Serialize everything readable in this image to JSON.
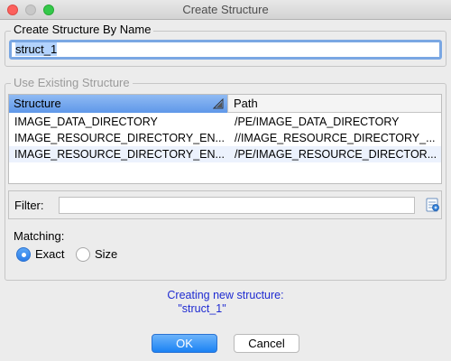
{
  "window": {
    "title": "Create Structure"
  },
  "create_by_name": {
    "legend": "Create Structure By Name",
    "value": "struct_1"
  },
  "use_existing": {
    "legend": "Use Existing Structure",
    "columns": [
      "Structure",
      "Path"
    ],
    "rows": [
      {
        "structure": "IMAGE_DATA_DIRECTORY",
        "path": "/PE/IMAGE_DATA_DIRECTORY"
      },
      {
        "structure": "IMAGE_RESOURCE_DIRECTORY_EN...",
        "path": "//IMAGE_RESOURCE_DIRECTORY_..."
      },
      {
        "structure": "IMAGE_RESOURCE_DIRECTORY_EN...",
        "path": "/PE/IMAGE_RESOURCE_DIRECTOR..."
      }
    ]
  },
  "filter": {
    "label": "Filter:",
    "value": ""
  },
  "matching": {
    "label": "Matching:",
    "options": [
      {
        "label": "Exact",
        "selected": true
      },
      {
        "label": "Size",
        "selected": false
      }
    ]
  },
  "status": {
    "line1": "Creating new structure:",
    "line2": "\"struct_1\""
  },
  "buttons": {
    "ok": "OK",
    "cancel": "Cancel"
  },
  "colors": {
    "accent": "#1b82f4",
    "status_text": "#1f2bd1"
  }
}
